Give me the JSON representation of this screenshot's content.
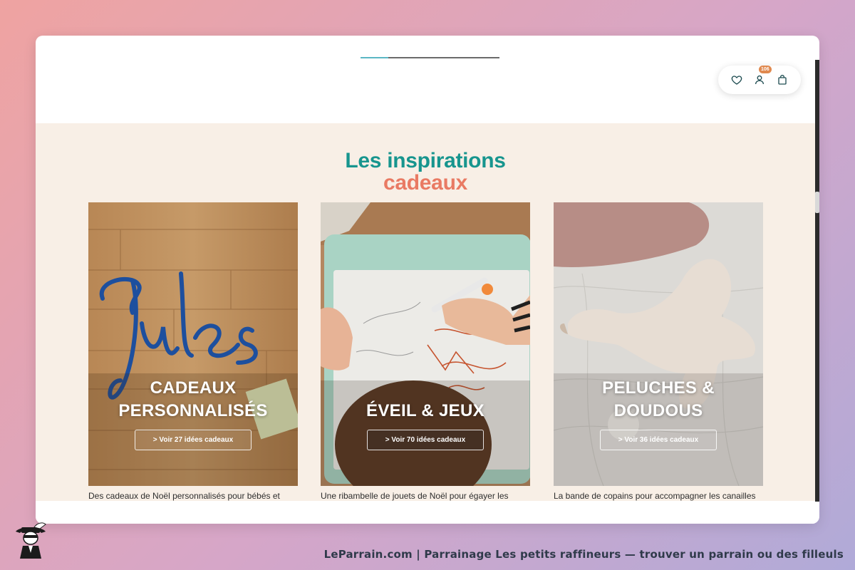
{
  "header": {
    "scroll_progress_pct": 20,
    "icons": {
      "wishlist": "heart-icon",
      "account": "user-icon",
      "cart": "shopping-bag-icon"
    },
    "account_badge": "106"
  },
  "section": {
    "title_line1": "Les inspirations",
    "title_line2": "cadeaux",
    "colors": {
      "title_teal": "#17958e",
      "title_coral": "#e97a63",
      "background": "#f8efe6"
    },
    "cards": [
      {
        "title_line1": "CADEAUX",
        "title_line2": "PERSONNALISÉS",
        "button": "> Voir 27 idées cadeaux",
        "description": "Des cadeaux de Noël personnalisés pour bébés et"
      },
      {
        "title_line1": "",
        "title_line2": "ÉVEIL & JEUX",
        "button": "> Voir 70 idées cadeaux",
        "description": "Une ribambelle de jouets de Noël pour égayer les"
      },
      {
        "title_line1": "PELUCHES &",
        "title_line2": "DOUDOUS",
        "button": "> Voir 36 idées cadeaux",
        "description": "La bande de copains pour accompagner les canailles"
      }
    ]
  },
  "footer": {
    "text": "LeParrain.com | Parrainage Les petits raffineurs — trouver un parrain ou des filleuls"
  }
}
